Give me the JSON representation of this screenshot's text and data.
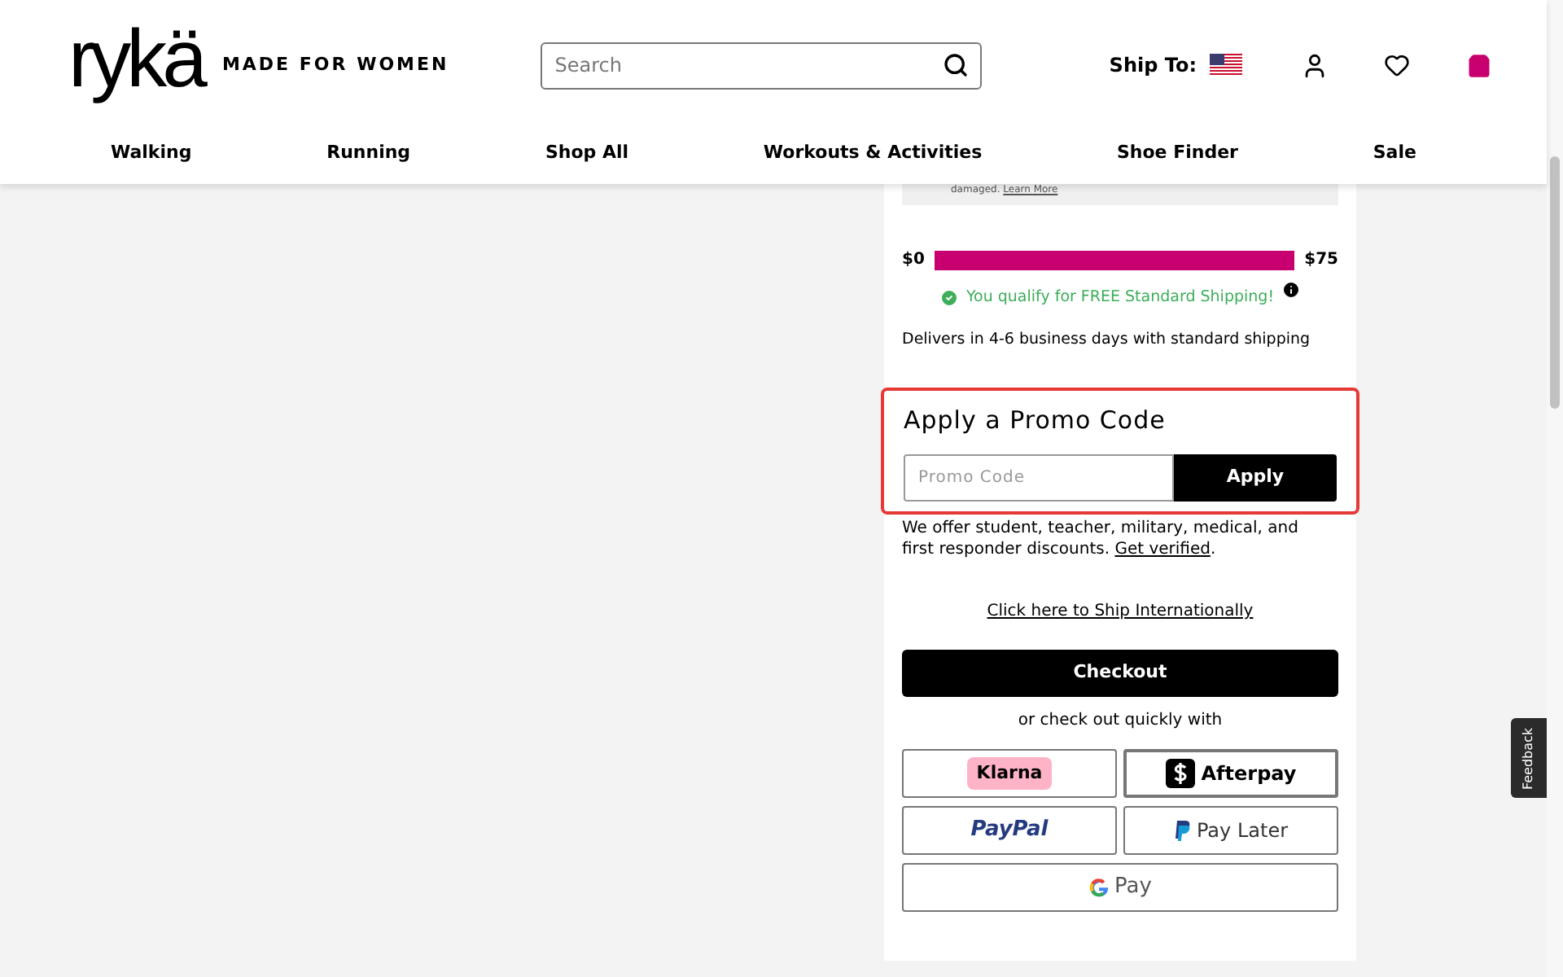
{
  "header": {
    "logo": "rykä",
    "tagline": "MADE FOR WOMEN",
    "search": {
      "placeholder": "Search"
    },
    "ship_to": "Ship To:"
  },
  "nav": [
    {
      "label": "Walking"
    },
    {
      "label": "Running"
    },
    {
      "label": "Shop All"
    },
    {
      "label": "Workouts & Activities"
    },
    {
      "label": "Shoe Finder"
    },
    {
      "label": "Sale"
    }
  ],
  "notice": {
    "text": "damaged.",
    "link": "Learn More"
  },
  "shipping": {
    "min": "$0",
    "max": "$75",
    "level": 1,
    "qualify": "You qualify for FREE Standard Shipping!",
    "delivery": "Delivers in 4-6 business days with standard shipping"
  },
  "promo": {
    "title": "Apply a Promo Code",
    "highlighted": true,
    "placeholder": "Promo Code",
    "button": "Apply",
    "note": "We offer student, teacher, military, medical, and first responder discounts.",
    "link": "Get verified",
    "after": "."
  },
  "ship_international": "Click here to Ship Internationally",
  "checkout": "Checkout",
  "quick": "or check out quickly with",
  "payments": [
    {
      "kind": "klarna",
      "label": "Klarna"
    },
    {
      "kind": "afterpay",
      "label": "Afterpay"
    },
    {
      "kind": "paypal",
      "label": "PayPal"
    },
    {
      "kind": "paylater",
      "label": "Pay Later"
    },
    {
      "kind": "gpay",
      "label": "Pay"
    }
  ],
  "feedback": "Feedback"
}
